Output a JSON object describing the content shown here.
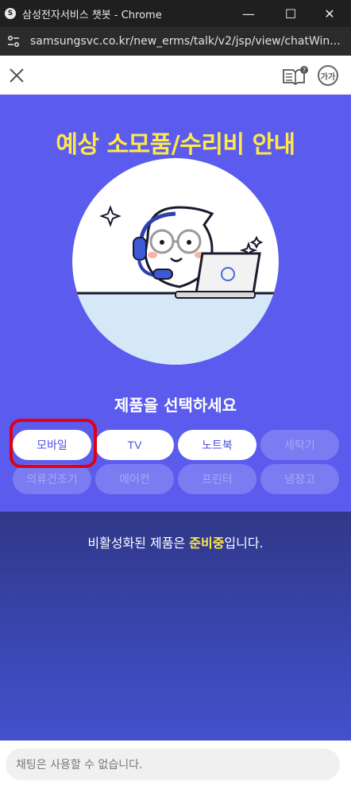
{
  "window": {
    "app_icon": "S",
    "title": "삼성전자서비스 챗봇 - Chrome",
    "min_glyph": "—",
    "max_glyph": "☐",
    "close_glyph": "✕"
  },
  "address_bar": {
    "url": "samsungsvc.co.kr/new_erms/talk/v2/jsp/view/chatWin..."
  },
  "header": {
    "close_icon": "close-icon",
    "guide_icon": "guide-book-icon",
    "font_size_label": "가가"
  },
  "hero": {
    "title": "예상 소모품/수리비 안내",
    "subtitle": "제품을 선택하세요",
    "illustration": "chatbot-mascot-with-laptop",
    "bg_color": "#5b5cee",
    "title_color": "#ffe84a"
  },
  "products": [
    {
      "label": "모바일",
      "state": "active"
    },
    {
      "label": "TV",
      "state": "active"
    },
    {
      "label": "노트북",
      "state": "active"
    },
    {
      "label": "세탁기",
      "state": "disabled"
    },
    {
      "label": "의류건조기",
      "state": "disabled"
    },
    {
      "label": "에어컨",
      "state": "disabled"
    },
    {
      "label": "프린터",
      "state": "disabled"
    },
    {
      "label": "냉장고",
      "state": "disabled"
    }
  ],
  "notice": {
    "prefix": "비활성화된 제품은 ",
    "highlight": "준비중",
    "suffix": "입니다."
  },
  "chat": {
    "placeholder": "채팅은 사용할 수 없습니다."
  }
}
